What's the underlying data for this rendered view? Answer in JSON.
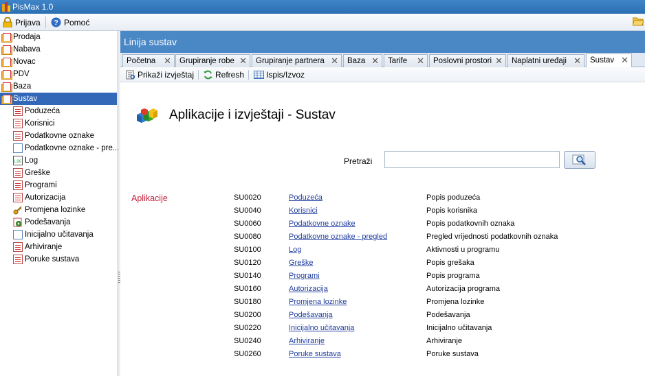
{
  "window": {
    "title": "PisMax 1.0"
  },
  "menu": {
    "login": "Prijava",
    "help": "Pomoć"
  },
  "tree": {
    "top": [
      {
        "label": "Prodaja"
      },
      {
        "label": "Nabava"
      },
      {
        "label": "Novac"
      },
      {
        "label": "PDV"
      },
      {
        "label": "Baza"
      },
      {
        "label": "Sustav"
      }
    ],
    "children": [
      {
        "label": "Poduzeća",
        "icon": "report-icon"
      },
      {
        "label": "Korisnici",
        "icon": "report-icon"
      },
      {
        "label": "Podatkovne oznake",
        "icon": "report-icon"
      },
      {
        "label": "Podatkovne oznake - pre...",
        "icon": "document-icon"
      },
      {
        "label": "Log",
        "icon": "log-icon"
      },
      {
        "label": "Greške",
        "icon": "report-icon"
      },
      {
        "label": "Programi",
        "icon": "report-icon"
      },
      {
        "label": "Autorizacija",
        "icon": "report-icon"
      },
      {
        "label": "Promjena lozinke",
        "icon": "key-icon"
      },
      {
        "label": "Podešavanja",
        "icon": "settings-icon"
      },
      {
        "label": "Inicijalno učitavanja",
        "icon": "document-icon"
      },
      {
        "label": "Arhiviranje",
        "icon": "report-icon"
      },
      {
        "label": "Poruke sustava",
        "icon": "report-icon"
      }
    ]
  },
  "panel": {
    "title": "Linija sustav"
  },
  "tabs": [
    {
      "label": "Početna"
    },
    {
      "label": "Grupiranje robe"
    },
    {
      "label": "Grupiranje partnera"
    },
    {
      "label": "Baza"
    },
    {
      "label": "Tarife"
    },
    {
      "label": "Poslovni prostori"
    },
    {
      "label": "Naplatni uređaji"
    },
    {
      "label": "Sustav",
      "active": true
    }
  ],
  "toolbar": {
    "show_report": "Prikaži izvještaj",
    "refresh": "Refresh",
    "print": "Ispis/Izvoz"
  },
  "heading": "Aplikacije i izvještaji - Sustav",
  "search": {
    "label": "Pretraži",
    "value": ""
  },
  "section": "Aplikacije",
  "apps": [
    {
      "code": "SU0020",
      "name": "Poduzeća",
      "desc": "Popis poduzeća"
    },
    {
      "code": "SU0040",
      "name": "Korisnici",
      "desc": "Popis korisnika"
    },
    {
      "code": "SU0060",
      "name": "Podatkovne oznake",
      "desc": "Popis podatkovnih oznaka"
    },
    {
      "code": "SU0080",
      "name": "Podatkovne oznake - pregled",
      "desc": "Pregled vrijednosti podatkovnih oznaka"
    },
    {
      "code": "SU0100",
      "name": "Log",
      "desc": "Aktivnosti u programu"
    },
    {
      "code": "SU0120",
      "name": "Greške",
      "desc": "Popis grešaka"
    },
    {
      "code": "SU0140",
      "name": "Programi",
      "desc": "Popis programa"
    },
    {
      "code": "SU0160",
      "name": "Autorizacija",
      "desc": "Autorizacija programa"
    },
    {
      "code": "SU0180",
      "name": "Promjena lozinke",
      "desc": "Promjena lozinke"
    },
    {
      "code": "SU0200",
      "name": "Podešavanja",
      "desc": "Podešavanja"
    },
    {
      "code": "SU0220",
      "name": "Inicijalno učitavanja",
      "desc": "Inicijalno učitavanja"
    },
    {
      "code": "SU0240",
      "name": "Arhiviranje",
      "desc": "Arhiviranje"
    },
    {
      "code": "SU0260",
      "name": "Poruke sustava",
      "desc": "Poruke sustava"
    }
  ]
}
